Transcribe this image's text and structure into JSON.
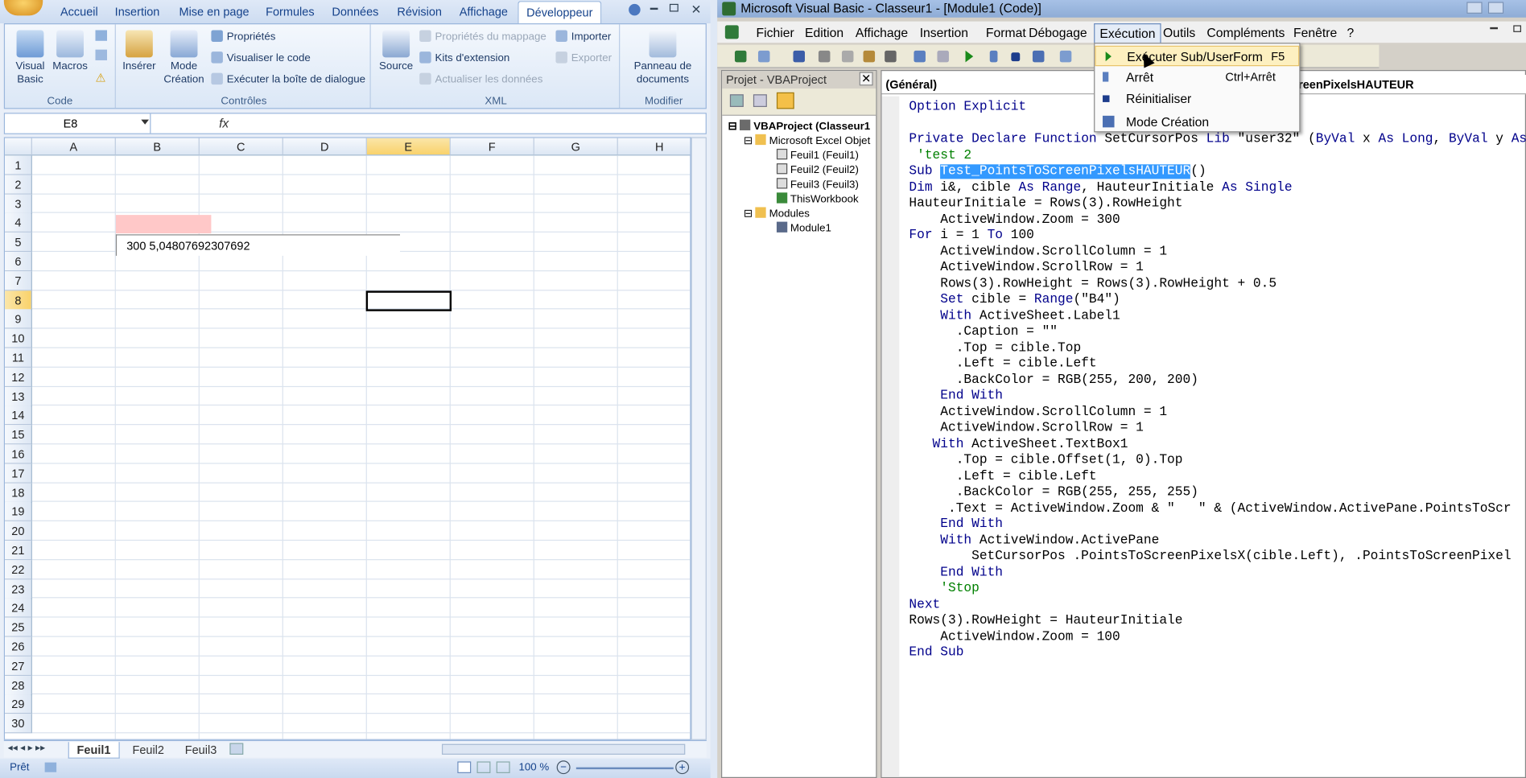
{
  "excel": {
    "tabs": [
      "Accueil",
      "Insertion",
      "Mise en page",
      "Formules",
      "Données",
      "Révision",
      "Affichage",
      "Développeur"
    ],
    "ribbon": {
      "code_group": {
        "title": "Code",
        "visual_basic": "Visual Basic",
        "macros": "Macros"
      },
      "controls_group": {
        "title": "Contrôles",
        "inserer": "Insérer",
        "mode_creation": "Mode Création",
        "proprietes": "Propriétés",
        "visualiser": "Visualiser le code",
        "executer_dialogue": "Exécuter la boîte de dialogue"
      },
      "xml_group": {
        "title": "XML",
        "source": "Source",
        "proprietes_mappage": "Propriétés du mappage",
        "kits": "Kits d'extension",
        "actualiser": "Actualiser les données",
        "importer": "Importer",
        "exporter": "Exporter"
      },
      "modifier_group": {
        "title": "Modifier",
        "panneau": "Panneau de documents"
      }
    },
    "namebox": "E8",
    "fx": "fx",
    "columns": [
      "A",
      "B",
      "C",
      "D",
      "E",
      "F",
      "G",
      "H"
    ],
    "rows": [
      "1",
      "2",
      "3",
      "4",
      "5",
      "6",
      "7",
      "8",
      "9",
      "10",
      "11",
      "12",
      "13",
      "14",
      "15",
      "16",
      "17",
      "18",
      "19",
      "20",
      "21",
      "22",
      "23",
      "24",
      "25",
      "26",
      "27",
      "28",
      "29",
      "30"
    ],
    "textbox_text": "300   5,04807692307692",
    "sheets": [
      "Feuil1",
      "Feuil2",
      "Feuil3"
    ],
    "status": "Prêt",
    "zoom": "100 %"
  },
  "vbe": {
    "title": "Microsoft Visual Basic - Classeur1 - [Module1 (Code)]",
    "menus": [
      "Fichier",
      "Edition",
      "Affichage",
      "Insertion",
      "Format",
      "Débogage",
      "Exécution",
      "Outils",
      "Compléments",
      "Fenêtre",
      "?"
    ],
    "project_title": "Projet - VBAProject",
    "tree": {
      "root": "VBAProject (Classeur1",
      "excel_objects": "Microsoft Excel Objet",
      "sheet1": "Feuil1 (Feuil1)",
      "sheet2": "Feuil2 (Feuil2)",
      "sheet3": "Feuil3 (Feuil3)",
      "workbook": "ThisWorkbook",
      "modules": "Modules",
      "module1": "Module1"
    },
    "combo_left": "(Général)",
    "combo_right": "reenPixelsHAUTEUR",
    "dropdown": [
      {
        "label": "Exécuter Sub/UserForm",
        "key": "F5"
      },
      {
        "label": "Arrêt",
        "key": "Ctrl+Arrêt"
      },
      {
        "label": "Réinitialiser",
        "key": ""
      },
      {
        "label": "Mode Création",
        "key": ""
      }
    ],
    "code": [
      "Option Explicit",
      "",
      "Private Declare Function SetCursorPos Lib \"user32\" (ByVal x As Long, ByVal y As",
      " 'test 2",
      "Sub Test_PointsToScreenPixelsHAUTEUR()",
      "Dim i&, cible As Range, HauteurInitiale As Single",
      "HauteurInitiale = Rows(3).RowHeight",
      "    ActiveWindow.Zoom = 300",
      "For i = 1 To 100",
      "    ActiveWindow.ScrollColumn = 1",
      "    ActiveWindow.ScrollRow = 1",
      "    Rows(3).RowHeight = Rows(3).RowHeight + 0.5",
      "    Set cible = Range(\"B4\")",
      "    With ActiveSheet.Label1",
      "      .Caption = \"\"",
      "      .Top = cible.Top",
      "      .Left = cible.Left",
      "      .BackColor = RGB(255, 200, 200)",
      "    End With",
      "    ActiveWindow.ScrollColumn = 1",
      "    ActiveWindow.ScrollRow = 1",
      "   With ActiveSheet.TextBox1",
      "      .Top = cible.Offset(1, 0).Top",
      "      .Left = cible.Left",
      "      .BackColor = RGB(255, 255, 255)",
      "     .Text = ActiveWindow.Zoom & \"   \" & (ActiveWindow.ActivePane.PointsToScr",
      "    End With",
      "    With ActiveWindow.ActivePane",
      "        SetCursorPos .PointsToScreenPixelsX(cible.Left), .PointsToScreenPixel",
      "    End With",
      "    'Stop",
      "Next",
      "Rows(3).RowHeight = HauteurInitiale",
      "    ActiveWindow.Zoom = 100",
      "End Sub"
    ]
  }
}
